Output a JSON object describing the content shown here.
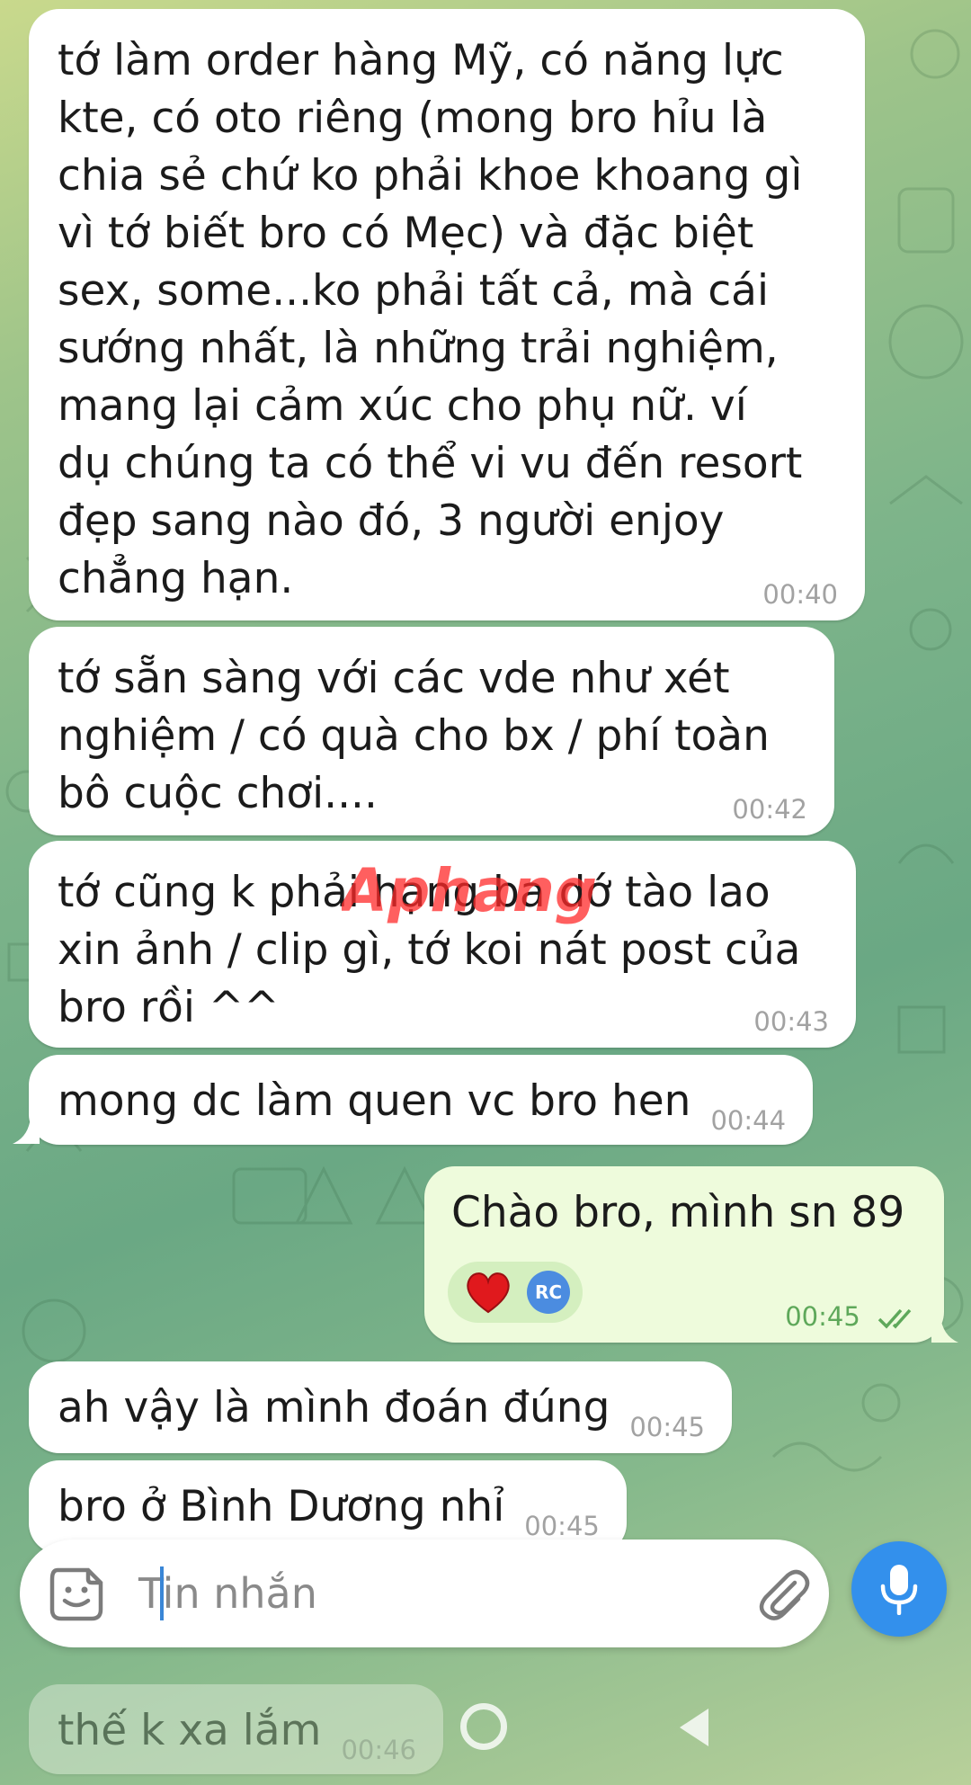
{
  "messages": [
    {
      "text": "tớ làm order hàng Mỹ, có năng lực\nkte, có oto riêng (mong bro hỉu là\nchia sẻ chứ ko phải khoe khoang gì\nvì tớ biết bro có Mẹc) và đặc biệt\nsex, some...ko phải tất cả, mà cái\nsướng nhất, là những trải nghiệm,\nmang lại cảm xúc cho phụ nữ. ví\ndụ chúng ta có thể vi vu đến resort\nđẹp sang nào đó, 3 người enjoy\nchẳng hạn.",
      "time": "00:40"
    },
    {
      "text": "tớ sẵn sàng với các vde như xét\nnghiệm / có quà cho bx / phí toàn\nbô cuộc chơi....",
      "time": "00:42"
    },
    {
      "text": "tớ cũng k phải hạng ba dớ tào lao\nxin ảnh / clip gì, tớ koi nát post của\nbro rồi ^^",
      "time": "00:43"
    },
    {
      "text": "mong dc làm quen vc bro hen",
      "time": "00:44"
    },
    {
      "text": "ah vậy là mình đoán đúng",
      "time": "00:45"
    },
    {
      "text": "bro ở Bình Dương nhỉ",
      "time": "00:45"
    },
    {
      "text": "thế k xa lắm",
      "time": "00:46"
    }
  ],
  "outgoing": {
    "text": "Chào bro, mình sn 89",
    "time": "00:45",
    "reaction_initials": "RC",
    "reaction_icon": "heart-icon"
  },
  "input": {
    "placeholder": "Tin nhắn"
  },
  "watermark": "Aphang",
  "colors": {
    "accent": "#3390ec",
    "outgoing_bubble": "#eefbdc",
    "heart": "#e0191d"
  }
}
